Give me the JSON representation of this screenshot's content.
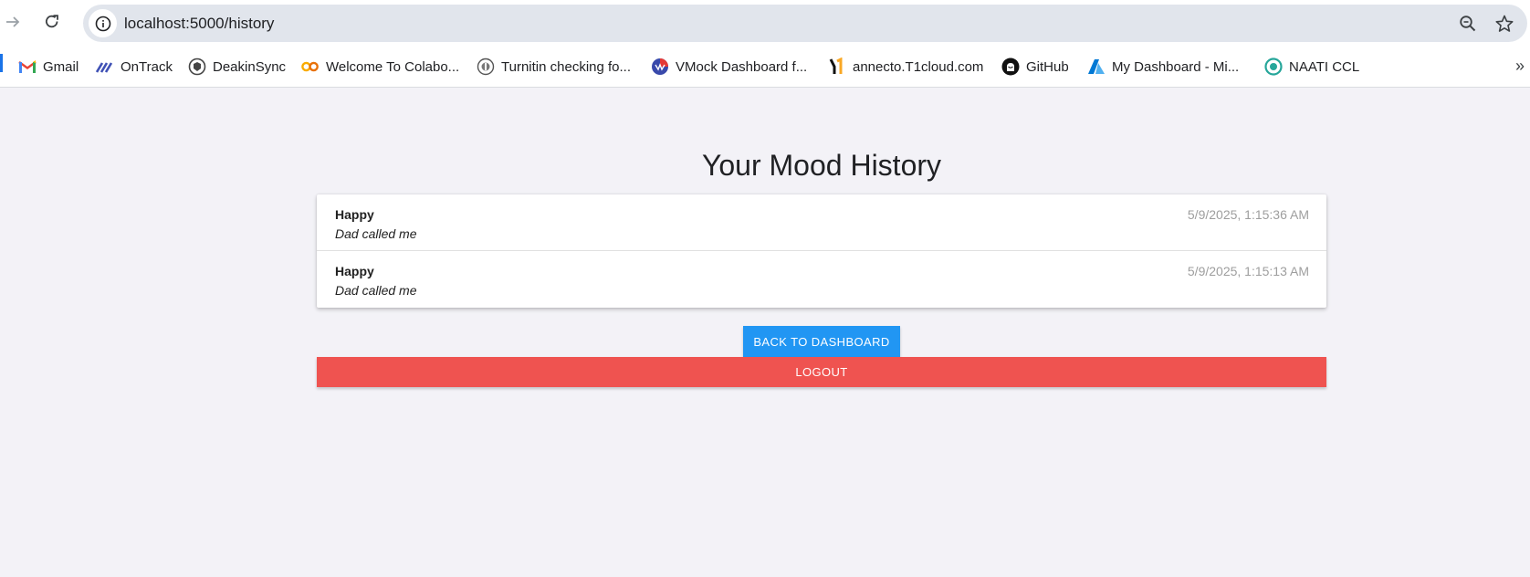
{
  "browser": {
    "url": "localhost:5000/history",
    "bookmarks": [
      {
        "label": "Gmail",
        "icon": "gmail-icon"
      },
      {
        "label": "OnTrack",
        "icon": "ontrack-icon"
      },
      {
        "label": "DeakinSync",
        "icon": "deakinsync-icon"
      },
      {
        "label": "Welcome To Colabo...",
        "icon": "colab-icon"
      },
      {
        "label": "Turnitin checking fo...",
        "icon": "turnitin-icon"
      },
      {
        "label": "VMock Dashboard f...",
        "icon": "vmock-icon"
      },
      {
        "label": "annecto.T1cloud.com",
        "icon": "t1cloud-icon"
      },
      {
        "label": "GitHub",
        "icon": "github-icon"
      },
      {
        "label": "My Dashboard - Mi...",
        "icon": "azure-icon"
      },
      {
        "label": "NAATI CCL",
        "icon": "naati-icon"
      }
    ],
    "more_label": "»"
  },
  "page": {
    "title": "Your Mood History",
    "entries": [
      {
        "mood": "Happy",
        "note": "Dad called me",
        "timestamp": "5/9/2025, 1:15:36 AM"
      },
      {
        "mood": "Happy",
        "note": "Dad called me",
        "timestamp": "5/9/2025, 1:15:13 AM"
      }
    ],
    "back_label": "BACK TO DASHBOARD",
    "logout_label": "LOGOUT"
  },
  "colors": {
    "primary": "#2196f3",
    "danger": "#ef5350",
    "background": "#f3f2f7"
  }
}
